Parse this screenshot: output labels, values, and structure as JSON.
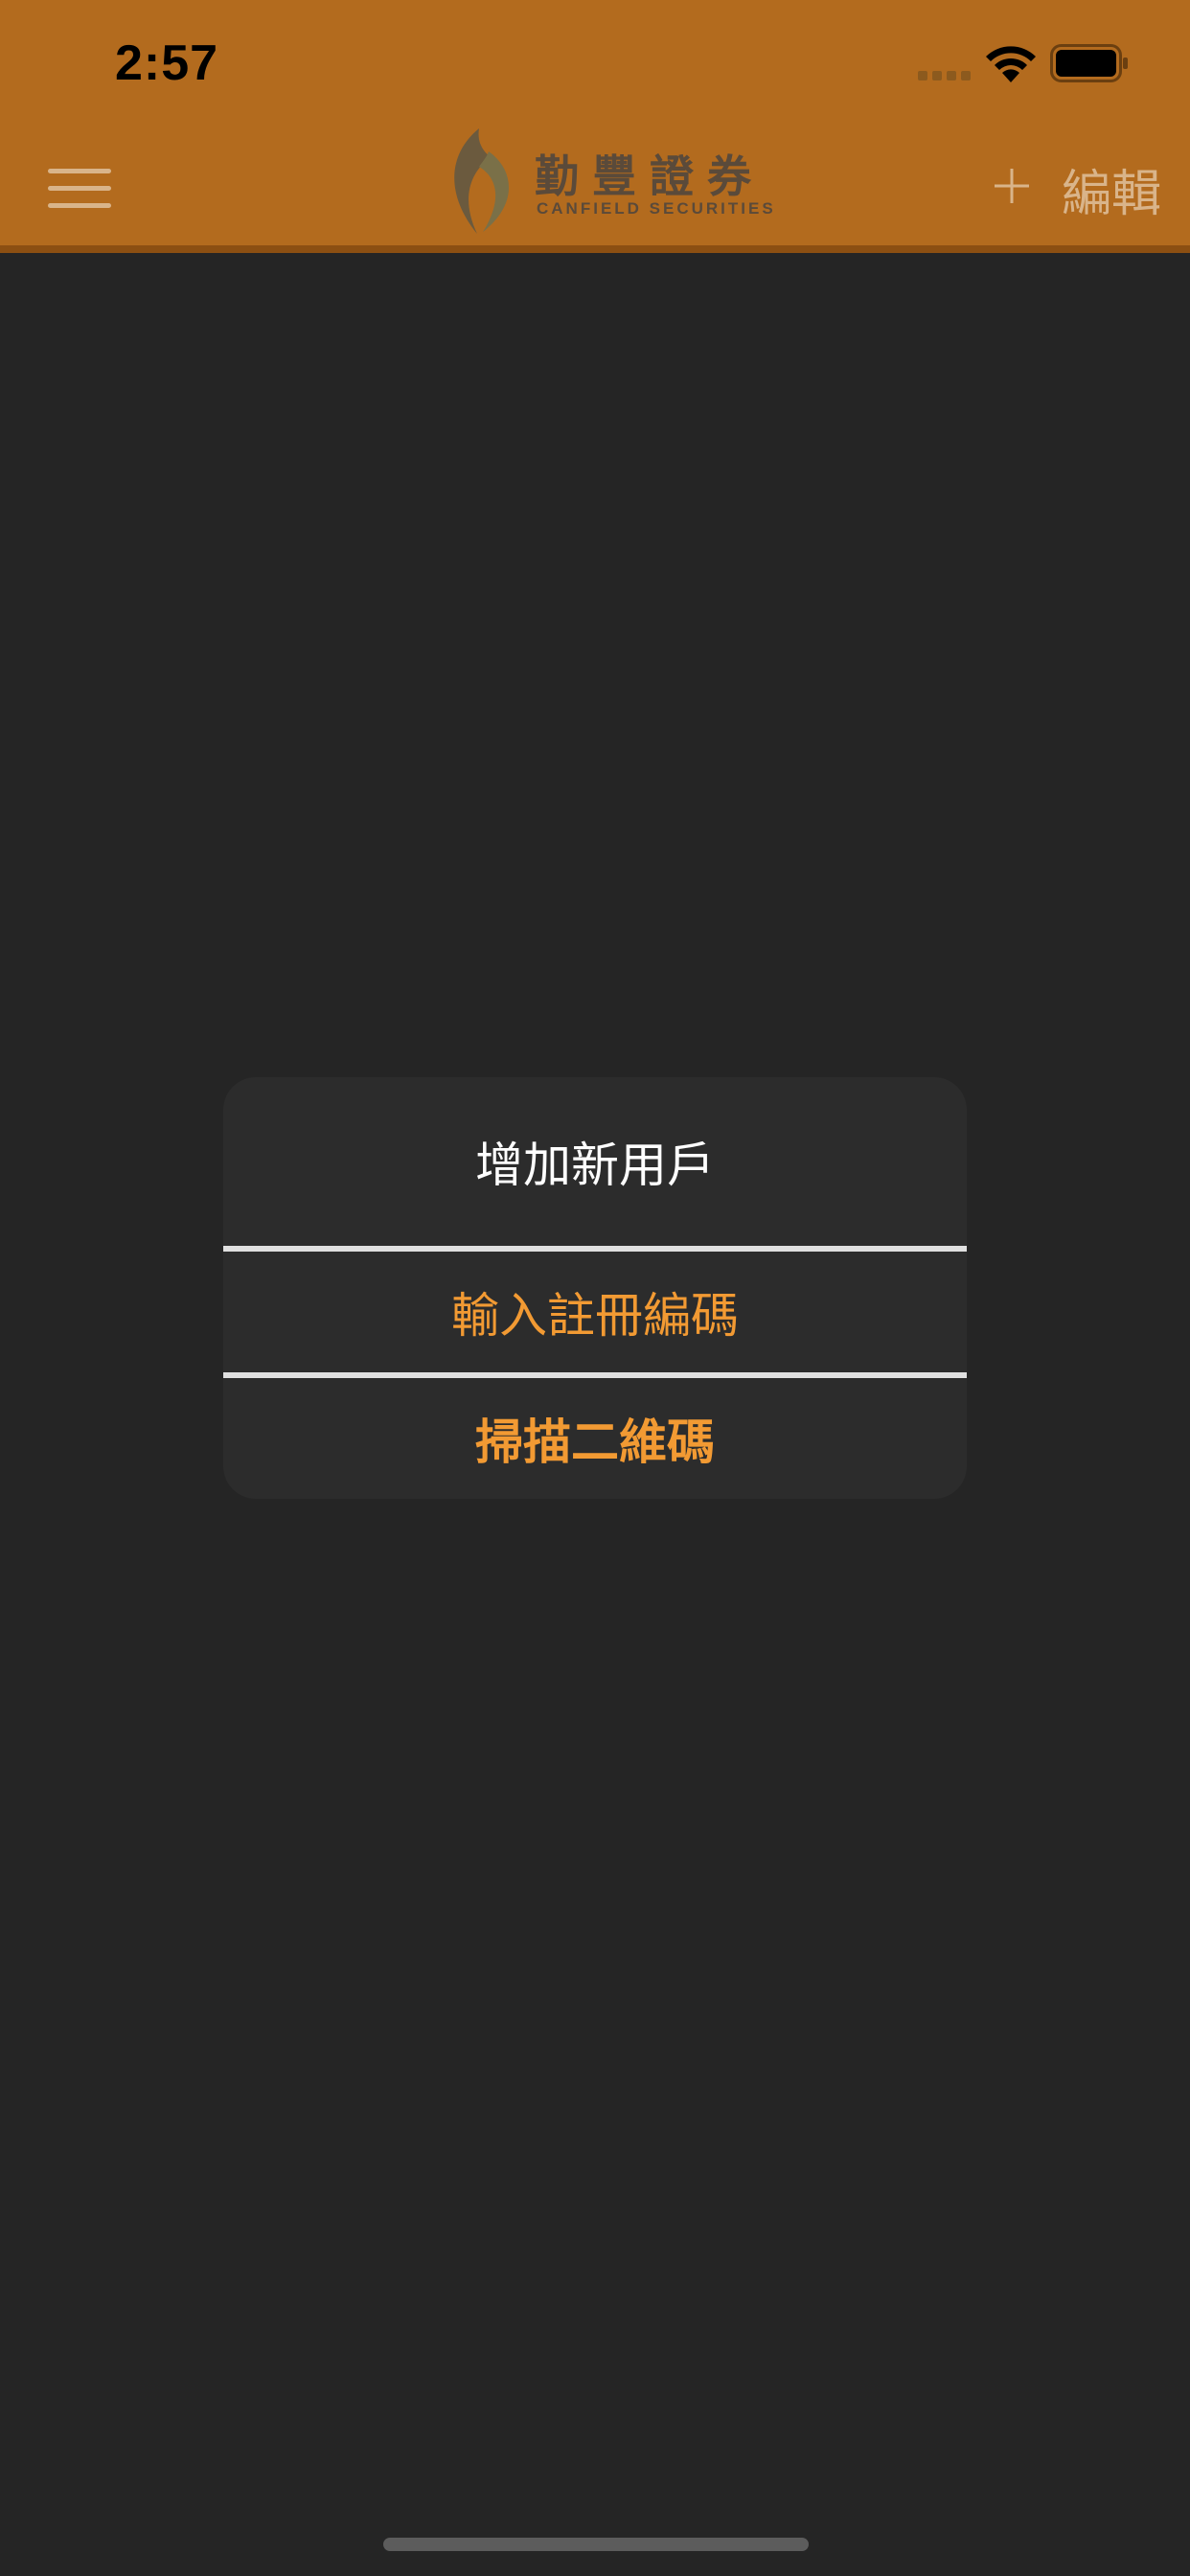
{
  "status_bar": {
    "time": "2:57",
    "icons": [
      "signal-icon",
      "wifi-icon",
      "battery-icon"
    ]
  },
  "nav": {
    "menu_icon": "menu-icon",
    "logo": {
      "chinese_name": "勤豐證券",
      "english_name": "CANFIELD SECURITIES"
    },
    "add_icon": "plus-icon",
    "edit_label": "編輯"
  },
  "dialog": {
    "title": "增加新用戶",
    "options": [
      {
        "label": "輸入註冊編碼"
      },
      {
        "label": "掃描二維碼"
      }
    ]
  },
  "colors": {
    "header_background": "#B36B1E",
    "screen_background": "#252525",
    "dialog_background": "#2C2C2C",
    "accent": "#F29A33",
    "nav_tint": "#D9B48A"
  }
}
